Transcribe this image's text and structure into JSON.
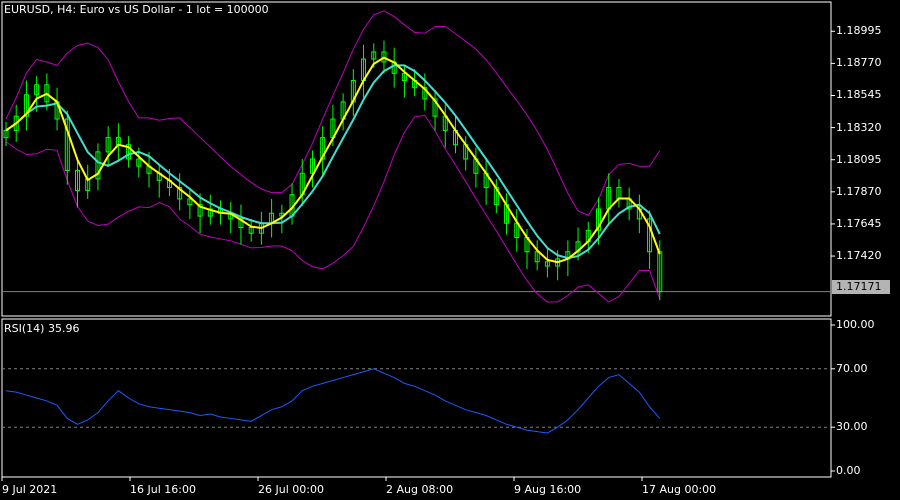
{
  "main_title": "EURUSD, H4:  Euro vs US Dollar - 1 lot = 100000",
  "rsi_title": "RSI(14) 35.96",
  "current_price": "1.17171",
  "colors": {
    "background": "#000000",
    "candle": "#00ff00",
    "bollinger": "#c000c0",
    "ma_fast": "#ffff00",
    "ma_slow": "#40e0d0",
    "rsi_line": "#1e5aff",
    "grid": "#808080"
  },
  "chart_data": [
    {
      "type": "candlestick",
      "title": "EURUSD, H4:  Euro vs US Dollar - 1 lot = 100000",
      "y_ticks": [
        "1.18995",
        "1.18770",
        "1.18545",
        "1.18320",
        "1.18095",
        "1.17870",
        "1.17645",
        "1.17420"
      ],
      "ylim": [
        1.17,
        1.192
      ],
      "x_tick_labels": [
        "9 Jul 2021",
        "16 Jul 16:00",
        "26 Jul 00:00",
        "2 Aug 08:00",
        "9 Aug 16:00",
        "17 Aug 00:00"
      ],
      "current_price": 1.17171,
      "close": [
        1.183,
        1.184,
        1.1855,
        1.1862,
        1.185,
        1.1838,
        1.1802,
        1.1788,
        1.1796,
        1.1815,
        1.1825,
        1.182,
        1.181,
        1.1805,
        1.18,
        1.1795,
        1.179,
        1.1782,
        1.1778,
        1.177,
        1.1775,
        1.1772,
        1.1768,
        1.1762,
        1.1758,
        1.1765,
        1.1772,
        1.177,
        1.1785,
        1.18,
        1.181,
        1.1825,
        1.1838,
        1.185,
        1.1865,
        1.188,
        1.1885,
        1.1878,
        1.187,
        1.1865,
        1.186,
        1.1852,
        1.184,
        1.183,
        1.182,
        1.181,
        1.18,
        1.179,
        1.1778,
        1.1765,
        1.1755,
        1.1745,
        1.1738,
        1.1735,
        1.174,
        1.1745,
        1.1752,
        1.176,
        1.1775,
        1.179,
        1.1782,
        1.1775,
        1.1768,
        1.1745,
        1.1717
      ]
    },
    {
      "type": "line",
      "title": "RSI(14) 35.96",
      "ylim": [
        0,
        100
      ],
      "y_ticks": [
        "100.00",
        "70.00",
        "30.00",
        "0.00"
      ],
      "levels": [
        70,
        30
      ],
      "values": [
        55,
        54,
        52,
        50,
        48,
        45,
        36,
        32,
        35,
        40,
        48,
        55,
        50,
        46,
        44,
        43,
        42,
        41,
        40,
        38,
        39,
        37,
        36,
        35,
        34,
        38,
        42,
        44,
        48,
        55,
        58,
        60,
        62,
        64,
        66,
        68,
        70,
        67,
        64,
        60,
        58,
        55,
        52,
        48,
        45,
        42,
        40,
        38,
        35,
        32,
        30,
        28,
        27,
        26,
        30,
        35,
        42,
        50,
        58,
        64,
        66,
        60,
        54,
        44,
        36
      ]
    }
  ]
}
